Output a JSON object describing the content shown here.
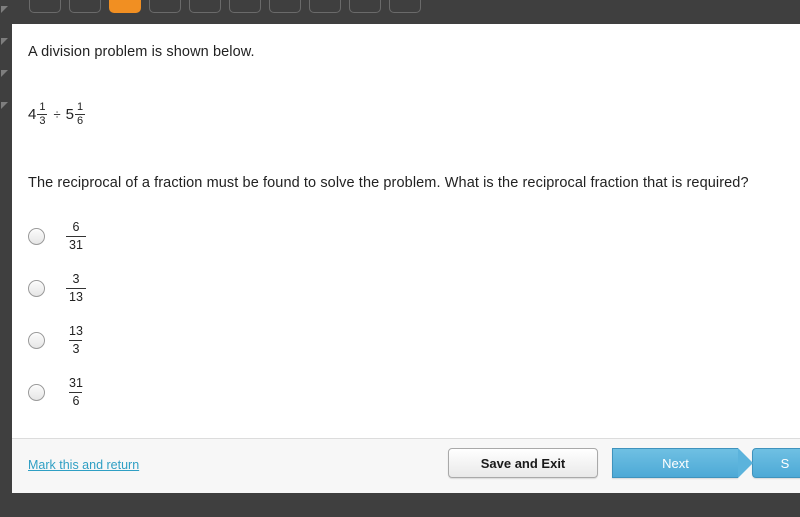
{
  "topbar": {
    "tab_count": 10,
    "current_tab_index": 2,
    "current_tab_color": "#f18f22",
    "bar_color": "#3f3f3f"
  },
  "question": {
    "intro": "A division problem is shown below.",
    "expression": {
      "left_whole": "4",
      "left_numerator": "1",
      "left_denominator": "3",
      "operator": "÷",
      "right_whole": "5",
      "right_numerator": "1",
      "right_denominator": "6"
    },
    "prompt": "The reciprocal of a fraction must be found to solve the problem. What is the reciprocal fraction that is required?",
    "choices": [
      {
        "numerator": "6",
        "denominator": "31",
        "selected": false
      },
      {
        "numerator": "3",
        "denominator": "13",
        "selected": false
      },
      {
        "numerator": "13",
        "denominator": "3",
        "selected": false
      },
      {
        "numerator": "31",
        "denominator": "6",
        "selected": false
      }
    ]
  },
  "footer": {
    "mark_link": "Mark this and return",
    "mark_link_color": "#2f9fc4",
    "save_button": "Save and Exit",
    "next_button": "Next",
    "submit_button": "S",
    "button_accent_color": "#5bb3dc"
  }
}
